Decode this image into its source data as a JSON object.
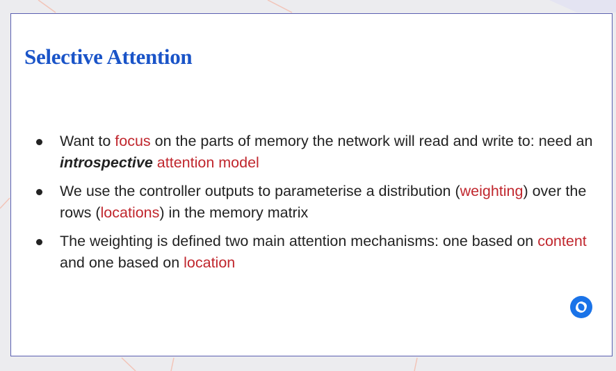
{
  "slide": {
    "title": "Selective Attention",
    "bullets": [
      {
        "pre": "Want to ",
        "hl1": "focus",
        "mid": " on the parts of memory the network will read and write to: need an ",
        "emph": "introspective",
        "hl2": " attention model"
      },
      {
        "pre": "We use the controller outputs to parameterise a distribution (",
        "hl1": "weighting",
        "mid": ") over the rows (",
        "hl2": "locations",
        "post": ") in the memory matrix"
      },
      {
        "pre": "The weighting is defined two main attention mechanisms: one based on ",
        "hl1": "content",
        "mid": " and one based on ",
        "hl2": "location"
      }
    ]
  },
  "colors": {
    "title": "#1a54c8",
    "highlight": "#c0262d",
    "border": "#5a5fb0",
    "logo": "#1a73e8"
  },
  "icons": {
    "logo": "deepmind-logo-icon"
  }
}
